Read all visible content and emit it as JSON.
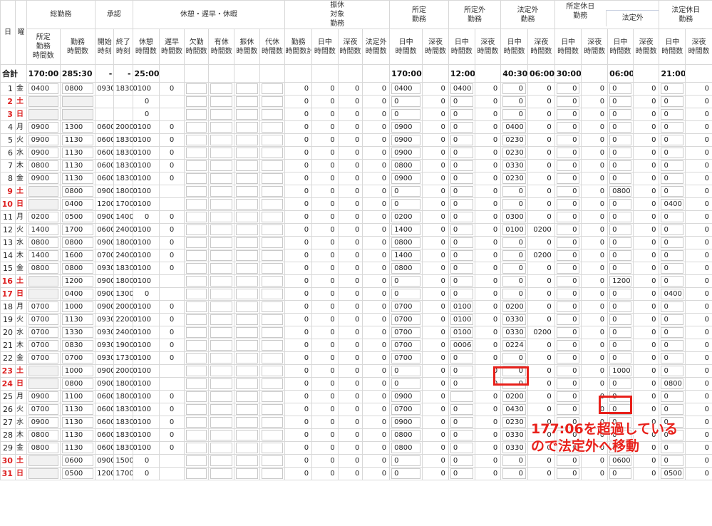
{
  "header": {
    "day": "日",
    "dow": "曜",
    "groups": {
      "total_work": "総勤務",
      "approval": "承認",
      "break": "休憩・遅早・休暇",
      "comp": [
        "振休",
        "対象",
        "勤務"
      ],
      "scheduled": [
        "所定",
        "勤務"
      ],
      "non_scheduled": [
        "所定外",
        "勤務"
      ],
      "statutory_over": [
        "法定外",
        "勤務"
      ],
      "sched_holiday": [
        "所定休日",
        "勤務"
      ],
      "statutory_over_sub": "法定外",
      "statutory_holiday": [
        "法定休日",
        "勤務"
      ]
    },
    "sub": {
      "sched_hours": [
        "所定",
        "勤務",
        "時間数"
      ],
      "work_hours": [
        "勤務",
        "時間数"
      ],
      "start": [
        "開始",
        "時刻"
      ],
      "end": [
        "終了",
        "時刻"
      ],
      "kyukei": [
        "休憩",
        "時間数"
      ],
      "chisou": [
        "遅早",
        "時間数"
      ],
      "kekkin": [
        "欠勤",
        "時間数"
      ],
      "yukyu": [
        "有休",
        "時間数"
      ],
      "furikyu": [
        "振休",
        "時間数"
      ],
      "daikyu": [
        "代休",
        "時間数"
      ],
      "kinmu_total": [
        "勤務",
        "時間数計"
      ],
      "day_hours": [
        "日中",
        "時間数"
      ],
      "night_hours": [
        "深夜",
        "時間数"
      ],
      "houteigai_hours": [
        "法定外",
        "時間数"
      ]
    }
  },
  "totals": {
    "label": "合計",
    "values": [
      "170:00",
      "285:30",
      "-",
      "-",
      "25:00",
      "",
      "",
      "",
      "",
      "",
      "",
      "",
      "",
      "",
      "170:00",
      "",
      "12:00",
      "",
      "40:30",
      "06:00",
      "30:00",
      "",
      "06:00",
      "",
      "21:00",
      ""
    ]
  },
  "rows": [
    {
      "d": "1",
      "w": "金",
      "hol": false,
      "v": [
        "0400",
        "0800",
        "0930",
        "1830",
        "0100",
        "0",
        "",
        "",
        "",
        "",
        "0",
        "0",
        "0",
        "0",
        "0400",
        "0",
        "0400",
        "0",
        "0",
        "0",
        "0",
        "0",
        "0",
        "0",
        "0",
        "0"
      ]
    },
    {
      "d": "2",
      "w": "土",
      "hol": true,
      "v": [
        "",
        "",
        "",
        "",
        "0",
        "",
        "",
        "",
        "",
        "",
        "0",
        "0",
        "0",
        "0",
        "0",
        "0",
        "0",
        "0",
        "0",
        "0",
        "0",
        "0",
        "0",
        "0",
        "0",
        "0"
      ]
    },
    {
      "d": "3",
      "w": "日",
      "hol": true,
      "v": [
        "",
        "",
        "",
        "",
        "0",
        "",
        "",
        "",
        "",
        "",
        "0",
        "0",
        "0",
        "0",
        "0",
        "0",
        "0",
        "0",
        "0",
        "0",
        "0",
        "0",
        "0",
        "0",
        "0",
        "0"
      ]
    },
    {
      "d": "4",
      "w": "月",
      "hol": false,
      "v": [
        "0900",
        "1300",
        "0600",
        "2000",
        "0100",
        "0",
        "",
        "",
        "",
        "",
        "0",
        "0",
        "0",
        "0",
        "0900",
        "0",
        "0",
        "0",
        "0400",
        "0",
        "0",
        "0",
        "0",
        "0",
        "0",
        "0"
      ]
    },
    {
      "d": "5",
      "w": "火",
      "hol": false,
      "v": [
        "0900",
        "1130",
        "0600",
        "1830",
        "0100",
        "0",
        "",
        "",
        "",
        "",
        "0",
        "0",
        "0",
        "0",
        "0900",
        "0",
        "0",
        "0",
        "0230",
        "0",
        "0",
        "0",
        "0",
        "0",
        "0",
        "0"
      ]
    },
    {
      "d": "6",
      "w": "水",
      "hol": false,
      "v": [
        "0900",
        "1130",
        "0600",
        "1830",
        "0100",
        "0",
        "",
        "",
        "",
        "",
        "0",
        "0",
        "0",
        "0",
        "0900",
        "0",
        "0",
        "0",
        "0230",
        "0",
        "0",
        "0",
        "0",
        "0",
        "0",
        "0"
      ]
    },
    {
      "d": "7",
      "w": "木",
      "hol": false,
      "v": [
        "0800",
        "1130",
        "0600",
        "1830",
        "0100",
        "0",
        "",
        "",
        "",
        "",
        "0",
        "0",
        "0",
        "0",
        "0800",
        "0",
        "0",
        "0",
        "0330",
        "0",
        "0",
        "0",
        "0",
        "0",
        "0",
        "0"
      ]
    },
    {
      "d": "8",
      "w": "金",
      "hol": false,
      "v": [
        "0900",
        "1130",
        "0600",
        "1830",
        "0100",
        "0",
        "",
        "",
        "",
        "",
        "0",
        "0",
        "0",
        "0",
        "0900",
        "0",
        "0",
        "0",
        "0230",
        "0",
        "0",
        "0",
        "0",
        "0",
        "0",
        "0"
      ]
    },
    {
      "d": "9",
      "w": "土",
      "hol": true,
      "v": [
        "",
        "0800",
        "0900",
        "1800",
        "0100",
        "",
        "",
        "",
        "",
        "",
        "0",
        "0",
        "0",
        "0",
        "0",
        "0",
        "0",
        "0",
        "0",
        "0",
        "0",
        "0",
        "0800",
        "0",
        "0",
        "0"
      ]
    },
    {
      "d": "10",
      "w": "日",
      "hol": true,
      "v": [
        "",
        "0400",
        "1200",
        "1700",
        "0100",
        "",
        "",
        "",
        "",
        "",
        "0",
        "0",
        "0",
        "0",
        "0",
        "0",
        "0",
        "0",
        "0",
        "0",
        "0",
        "0",
        "0",
        "0",
        "0400",
        "0"
      ]
    },
    {
      "d": "11",
      "w": "月",
      "hol": false,
      "v": [
        "0200",
        "0500",
        "0900",
        "1400",
        "0",
        "0",
        "",
        "",
        "",
        "",
        "0",
        "0",
        "0",
        "0",
        "0200",
        "0",
        "0",
        "0",
        "0300",
        "0",
        "0",
        "0",
        "0",
        "0",
        "0",
        "0"
      ]
    },
    {
      "d": "12",
      "w": "火",
      "hol": false,
      "v": [
        "1400",
        "1700",
        "0600",
        "2400",
        "0100",
        "0",
        "",
        "",
        "",
        "",
        "0",
        "0",
        "0",
        "0",
        "1400",
        "0",
        "0",
        "0",
        "0100",
        "0200",
        "0",
        "0",
        "0",
        "0",
        "0",
        "0"
      ]
    },
    {
      "d": "13",
      "w": "水",
      "hol": false,
      "v": [
        "0800",
        "0800",
        "0900",
        "1800",
        "0100",
        "0",
        "",
        "",
        "",
        "",
        "0",
        "0",
        "0",
        "0",
        "0800",
        "0",
        "0",
        "0",
        "0",
        "0",
        "0",
        "0",
        "0",
        "0",
        "0",
        "0"
      ]
    },
    {
      "d": "14",
      "w": "木",
      "hol": false,
      "v": [
        "1400",
        "1600",
        "0700",
        "2400",
        "0100",
        "0",
        "",
        "",
        "",
        "",
        "0",
        "0",
        "0",
        "0",
        "1400",
        "0",
        "0",
        "0",
        "0",
        "0200",
        "0",
        "0",
        "0",
        "0",
        "0",
        "0"
      ]
    },
    {
      "d": "15",
      "w": "金",
      "hol": false,
      "v": [
        "0800",
        "0800",
        "0930",
        "1830",
        "0100",
        "0",
        "",
        "",
        "",
        "",
        "0",
        "0",
        "0",
        "0",
        "0800",
        "0",
        "0",
        "0",
        "0",
        "0",
        "0",
        "0",
        "0",
        "0",
        "0",
        "0"
      ]
    },
    {
      "d": "16",
      "w": "土",
      "hol": true,
      "v": [
        "",
        "1200",
        "0900",
        "1800",
        "0100",
        "",
        "",
        "",
        "",
        "",
        "0",
        "0",
        "0",
        "0",
        "0",
        "0",
        "0",
        "0",
        "0",
        "0",
        "0",
        "0",
        "1200",
        "0",
        "0",
        "0"
      ]
    },
    {
      "d": "17",
      "w": "日",
      "hol": true,
      "v": [
        "",
        "0400",
        "0900",
        "1300",
        "0",
        "",
        "",
        "",
        "",
        "",
        "0",
        "0",
        "0",
        "0",
        "0",
        "0",
        "0",
        "0",
        "0",
        "0",
        "0",
        "0",
        "0",
        "0",
        "0400",
        "0"
      ]
    },
    {
      "d": "18",
      "w": "月",
      "hol": false,
      "v": [
        "0700",
        "1000",
        "0900",
        "2000",
        "0100",
        "0",
        "",
        "",
        "",
        "",
        "0",
        "0",
        "0",
        "0",
        "0700",
        "0",
        "0100",
        "0",
        "0200",
        "0",
        "0",
        "0",
        "0",
        "0",
        "0",
        "0"
      ]
    },
    {
      "d": "19",
      "w": "火",
      "hol": false,
      "v": [
        "0700",
        "1130",
        "0930",
        "2200",
        "0100",
        "0",
        "",
        "",
        "",
        "",
        "0",
        "0",
        "0",
        "0",
        "0700",
        "0",
        "0100",
        "0",
        "0330",
        "0",
        "0",
        "0",
        "0",
        "0",
        "0",
        "0"
      ]
    },
    {
      "d": "20",
      "w": "水",
      "hol": false,
      "v": [
        "0700",
        "1330",
        "0930",
        "2400",
        "0100",
        "0",
        "",
        "",
        "",
        "",
        "0",
        "0",
        "0",
        "0",
        "0700",
        "0",
        "0100",
        "0",
        "0330",
        "0200",
        "0",
        "0",
        "0",
        "0",
        "0",
        "0"
      ]
    },
    {
      "d": "21",
      "w": "木",
      "hol": false,
      "v": [
        "0700",
        "0830",
        "0930",
        "1900",
        "0100",
        "0",
        "",
        "",
        "",
        "",
        "0",
        "0",
        "0",
        "0",
        "0700",
        "0",
        "0006",
        "0",
        "0224",
        "0",
        "0",
        "0",
        "0",
        "0",
        "0",
        "0"
      ]
    },
    {
      "d": "22",
      "w": "金",
      "hol": false,
      "v": [
        "0700",
        "0700",
        "0930",
        "1730",
        "0100",
        "0",
        "",
        "",
        "",
        "",
        "0",
        "0",
        "0",
        "0",
        "0700",
        "0",
        "0",
        "0",
        "0",
        "0",
        "0",
        "0",
        "0",
        "0",
        "0",
        "0"
      ]
    },
    {
      "d": "23",
      "w": "土",
      "hol": true,
      "v": [
        "",
        "1000",
        "0900",
        "2000",
        "0100",
        "",
        "",
        "",
        "",
        "",
        "0",
        "0",
        "0",
        "0",
        "0",
        "0",
        "0",
        "0",
        "0",
        "0",
        "0",
        "0",
        "1000",
        "0",
        "0",
        "0"
      ]
    },
    {
      "d": "24",
      "w": "日",
      "hol": true,
      "v": [
        "",
        "0800",
        "0900",
        "1800",
        "0100",
        "",
        "",
        "",
        "",
        "",
        "0",
        "0",
        "0",
        "0",
        "0",
        "0",
        "0",
        "0",
        "0",
        "0",
        "0",
        "0",
        "0",
        "0",
        "0800",
        "0"
      ]
    },
    {
      "d": "25",
      "w": "月",
      "hol": false,
      "v": [
        "0900",
        "1100",
        "0600",
        "1800",
        "0100",
        "0",
        "",
        "",
        "",
        "",
        "0",
        "0",
        "0",
        "0",
        "0900",
        "0",
        "",
        "0",
        "0200",
        "0",
        "0",
        "0",
        "0",
        "0",
        "0",
        "0"
      ]
    },
    {
      "d": "26",
      "w": "火",
      "hol": false,
      "v": [
        "0700",
        "1130",
        "0600",
        "1830",
        "0100",
        "0",
        "",
        "",
        "",
        "",
        "0",
        "0",
        "0",
        "0",
        "0700",
        "0",
        "0",
        "0",
        "0430",
        "0",
        "0",
        "0",
        "0",
        "0",
        "0",
        "0"
      ]
    },
    {
      "d": "27",
      "w": "水",
      "hol": false,
      "v": [
        "0900",
        "1130",
        "0600",
        "1830",
        "0100",
        "0",
        "",
        "",
        "",
        "",
        "0",
        "0",
        "0",
        "0",
        "0900",
        "0",
        "0",
        "0",
        "0230",
        "0",
        "0",
        "0",
        "0",
        "0",
        "0",
        "0"
      ]
    },
    {
      "d": "28",
      "w": "木",
      "hol": false,
      "v": [
        "0800",
        "1130",
        "0600",
        "1830",
        "0100",
        "0",
        "",
        "",
        "",
        "",
        "0",
        "0",
        "0",
        "0",
        "0800",
        "0",
        "0",
        "0",
        "0330",
        "0",
        "0",
        "0",
        "0",
        "0",
        "0",
        "0"
      ]
    },
    {
      "d": "29",
      "w": "金",
      "hol": false,
      "v": [
        "0800",
        "1130",
        "0600",
        "1830",
        "0100",
        "0",
        "",
        "",
        "",
        "",
        "0",
        "0",
        "0",
        "0",
        "0800",
        "0",
        "0",
        "0",
        "0330",
        "0",
        "0",
        "0",
        "0",
        "0",
        "0",
        "0"
      ]
    },
    {
      "d": "30",
      "w": "土",
      "hol": true,
      "v": [
        "",
        "0600",
        "0900",
        "1500",
        "0",
        "",
        "",
        "",
        "",
        "",
        "0",
        "0",
        "0",
        "0",
        "0",
        "0",
        "0",
        "0",
        "0",
        "0",
        "0",
        "0",
        "0600",
        "0",
        "0",
        "0"
      ]
    },
    {
      "d": "31",
      "w": "日",
      "hol": true,
      "v": [
        "",
        "0500",
        "1200",
        "1700",
        "0",
        "",
        "",
        "",
        "",
        "",
        "0",
        "0",
        "0",
        "0",
        "0",
        "0",
        "0",
        "0",
        "0",
        "0",
        "0",
        "0",
        "0",
        "0",
        "0500",
        "0"
      ]
    }
  ],
  "annotation": {
    "line1": "177:06を超過している",
    "line2": "ので法定外へ移動"
  },
  "colors": {
    "highlight": "#e8201a",
    "holiday_text": "#dd2222"
  }
}
